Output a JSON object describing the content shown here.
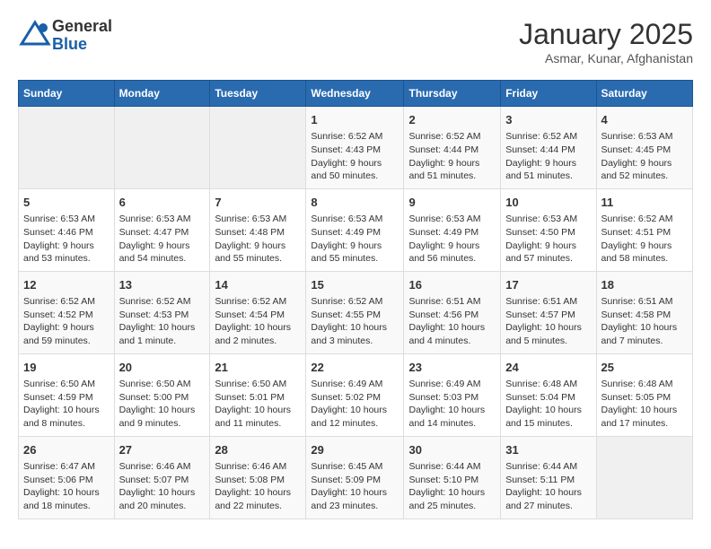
{
  "logo": {
    "general": "General",
    "blue": "Blue"
  },
  "title": "January 2025",
  "subtitle": "Asmar, Kunar, Afghanistan",
  "headers": [
    "Sunday",
    "Monday",
    "Tuesday",
    "Wednesday",
    "Thursday",
    "Friday",
    "Saturday"
  ],
  "weeks": [
    [
      {
        "day": "",
        "info": ""
      },
      {
        "day": "",
        "info": ""
      },
      {
        "day": "",
        "info": ""
      },
      {
        "day": "1",
        "info": "Sunrise: 6:52 AM\nSunset: 4:43 PM\nDaylight: 9 hours\nand 50 minutes."
      },
      {
        "day": "2",
        "info": "Sunrise: 6:52 AM\nSunset: 4:44 PM\nDaylight: 9 hours\nand 51 minutes."
      },
      {
        "day": "3",
        "info": "Sunrise: 6:52 AM\nSunset: 4:44 PM\nDaylight: 9 hours\nand 51 minutes."
      },
      {
        "day": "4",
        "info": "Sunrise: 6:53 AM\nSunset: 4:45 PM\nDaylight: 9 hours\nand 52 minutes."
      }
    ],
    [
      {
        "day": "5",
        "info": "Sunrise: 6:53 AM\nSunset: 4:46 PM\nDaylight: 9 hours\nand 53 minutes."
      },
      {
        "day": "6",
        "info": "Sunrise: 6:53 AM\nSunset: 4:47 PM\nDaylight: 9 hours\nand 54 minutes."
      },
      {
        "day": "7",
        "info": "Sunrise: 6:53 AM\nSunset: 4:48 PM\nDaylight: 9 hours\nand 55 minutes."
      },
      {
        "day": "8",
        "info": "Sunrise: 6:53 AM\nSunset: 4:49 PM\nDaylight: 9 hours\nand 55 minutes."
      },
      {
        "day": "9",
        "info": "Sunrise: 6:53 AM\nSunset: 4:49 PM\nDaylight: 9 hours\nand 56 minutes."
      },
      {
        "day": "10",
        "info": "Sunrise: 6:53 AM\nSunset: 4:50 PM\nDaylight: 9 hours\nand 57 minutes."
      },
      {
        "day": "11",
        "info": "Sunrise: 6:52 AM\nSunset: 4:51 PM\nDaylight: 9 hours\nand 58 minutes."
      }
    ],
    [
      {
        "day": "12",
        "info": "Sunrise: 6:52 AM\nSunset: 4:52 PM\nDaylight: 9 hours\nand 59 minutes."
      },
      {
        "day": "13",
        "info": "Sunrise: 6:52 AM\nSunset: 4:53 PM\nDaylight: 10 hours\nand 1 minute."
      },
      {
        "day": "14",
        "info": "Sunrise: 6:52 AM\nSunset: 4:54 PM\nDaylight: 10 hours\nand 2 minutes."
      },
      {
        "day": "15",
        "info": "Sunrise: 6:52 AM\nSunset: 4:55 PM\nDaylight: 10 hours\nand 3 minutes."
      },
      {
        "day": "16",
        "info": "Sunrise: 6:51 AM\nSunset: 4:56 PM\nDaylight: 10 hours\nand 4 minutes."
      },
      {
        "day": "17",
        "info": "Sunrise: 6:51 AM\nSunset: 4:57 PM\nDaylight: 10 hours\nand 5 minutes."
      },
      {
        "day": "18",
        "info": "Sunrise: 6:51 AM\nSunset: 4:58 PM\nDaylight: 10 hours\nand 7 minutes."
      }
    ],
    [
      {
        "day": "19",
        "info": "Sunrise: 6:50 AM\nSunset: 4:59 PM\nDaylight: 10 hours\nand 8 minutes."
      },
      {
        "day": "20",
        "info": "Sunrise: 6:50 AM\nSunset: 5:00 PM\nDaylight: 10 hours\nand 9 minutes."
      },
      {
        "day": "21",
        "info": "Sunrise: 6:50 AM\nSunset: 5:01 PM\nDaylight: 10 hours\nand 11 minutes."
      },
      {
        "day": "22",
        "info": "Sunrise: 6:49 AM\nSunset: 5:02 PM\nDaylight: 10 hours\nand 12 minutes."
      },
      {
        "day": "23",
        "info": "Sunrise: 6:49 AM\nSunset: 5:03 PM\nDaylight: 10 hours\nand 14 minutes."
      },
      {
        "day": "24",
        "info": "Sunrise: 6:48 AM\nSunset: 5:04 PM\nDaylight: 10 hours\nand 15 minutes."
      },
      {
        "day": "25",
        "info": "Sunrise: 6:48 AM\nSunset: 5:05 PM\nDaylight: 10 hours\nand 17 minutes."
      }
    ],
    [
      {
        "day": "26",
        "info": "Sunrise: 6:47 AM\nSunset: 5:06 PM\nDaylight: 10 hours\nand 18 minutes."
      },
      {
        "day": "27",
        "info": "Sunrise: 6:46 AM\nSunset: 5:07 PM\nDaylight: 10 hours\nand 20 minutes."
      },
      {
        "day": "28",
        "info": "Sunrise: 6:46 AM\nSunset: 5:08 PM\nDaylight: 10 hours\nand 22 minutes."
      },
      {
        "day": "29",
        "info": "Sunrise: 6:45 AM\nSunset: 5:09 PM\nDaylight: 10 hours\nand 23 minutes."
      },
      {
        "day": "30",
        "info": "Sunrise: 6:44 AM\nSunset: 5:10 PM\nDaylight: 10 hours\nand 25 minutes."
      },
      {
        "day": "31",
        "info": "Sunrise: 6:44 AM\nSunset: 5:11 PM\nDaylight: 10 hours\nand 27 minutes."
      },
      {
        "day": "",
        "info": ""
      }
    ]
  ]
}
